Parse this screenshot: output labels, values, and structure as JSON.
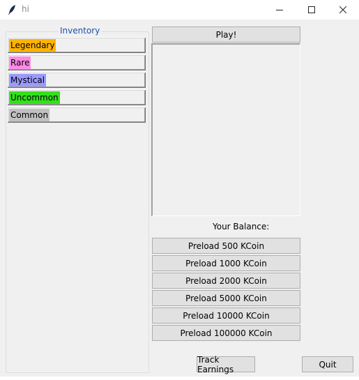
{
  "window": {
    "title": "hi",
    "icon": "feather-icon"
  },
  "inventory": {
    "label": "Inventory",
    "items": [
      {
        "label": "Legendary",
        "color": "#ffb300"
      },
      {
        "label": "Rare",
        "color": "#ff8ae6"
      },
      {
        "label": "Mystical",
        "color": "#9a9aff"
      },
      {
        "label": "Uncommon",
        "color": "#33e01a"
      },
      {
        "label": "Common",
        "color": "#c0c0c0"
      }
    ]
  },
  "play": {
    "label": "Play!"
  },
  "balance": {
    "label": "Your Balance:"
  },
  "preloads": [
    {
      "label": "Preload 500 KCoin"
    },
    {
      "label": "Preload 1000 KCoin"
    },
    {
      "label": "Preload 2000 KCoin"
    },
    {
      "label": "Preload 5000 KCoin"
    },
    {
      "label": "Preload 10000 KCoin"
    },
    {
      "label": "Preload 100000 KCoin"
    }
  ],
  "footer": {
    "track_label": "Track Earnings",
    "quit_label": "Quit"
  }
}
